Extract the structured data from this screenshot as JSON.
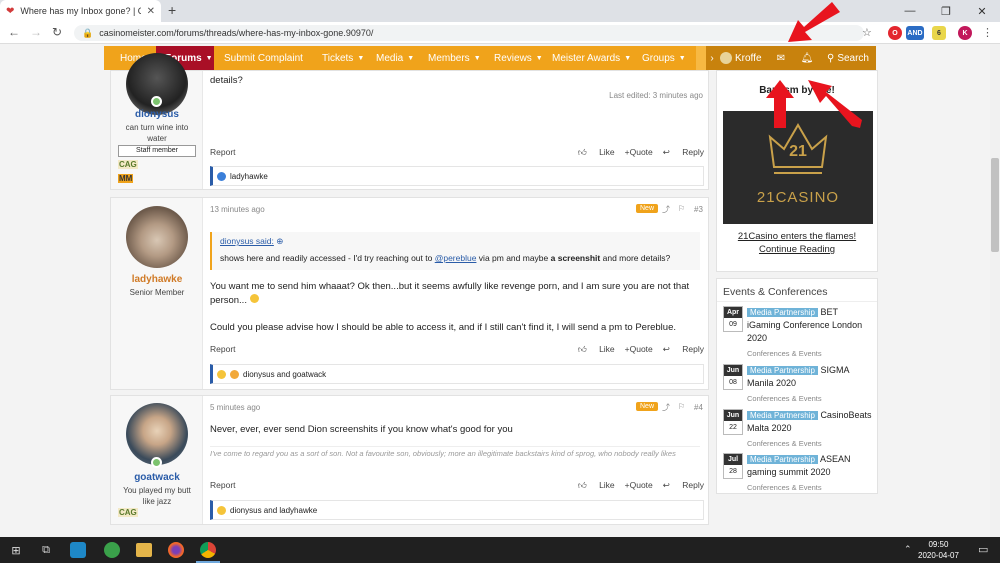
{
  "browser": {
    "tab_title": "Where has my Inbox gone? | Casi",
    "url": "casinomeister.com/forums/threads/where-has-my-inbox-gone.90970/",
    "ext_and": "AND",
    "ext_count": "6",
    "profile_letter": "K"
  },
  "nav": {
    "items": [
      "Home",
      "Forums",
      "Submit Complaint",
      "Tickets",
      "Media",
      "Members",
      "Reviews",
      "Meister Awards",
      "Groups"
    ],
    "user": "Kroffe",
    "search": "Search"
  },
  "posts": [
    {
      "username": "dionysus",
      "user_title": "can turn wine into water",
      "staff": "Staff member",
      "badges": [
        "CAG",
        "MM"
      ],
      "text": "details?",
      "edited": "Last edited: 3 minutes ago",
      "report": "Report",
      "like": "Like",
      "quote": "+Quote",
      "reply": "Reply",
      "reactions": "ladyhawke"
    },
    {
      "username": "ladyhawke",
      "user_title": "Senior Member",
      "time": "13 minutes ago",
      "new": "New",
      "num": "#3",
      "quote_author": "dionysus said:",
      "quote_text_a": "shows here and readily accessed - I'd try reaching out to ",
      "quote_mention": "@pereblue",
      "quote_text_b": " via pm and maybe ",
      "quote_bold": "a screenshit",
      "quote_text_c": " and more details?",
      "text1": "You want me to send him whaaat? Ok then...but it seems awfully like revenge porn, and I am sure you are not that person...",
      "text2": "Could you please advise how I should be able to access it, and if I still can't find it, I will send a pm to Pereblue.",
      "report": "Report",
      "like": "Like",
      "quote": "+Quote",
      "reply": "Reply",
      "reactions": "dionysus and goatwack"
    },
    {
      "username": "goatwack",
      "user_title": "You played my butt like jazz",
      "badges": [
        "CAG"
      ],
      "time": "5 minutes ago",
      "new": "New",
      "num": "#4",
      "text": "Never, ever, ever send Dion screenshits if you know what's good for you",
      "signature": "I've come to regard you as a sort of son. Not a favourite son, obviously; more an illegitimate backstairs kind of sprog, who nobody really likes",
      "report": "Report",
      "like": "Like",
      "quote": "+Quote",
      "reply": "Reply",
      "reactions": "dionysus and ladyhawke"
    }
  ],
  "sidebar": {
    "promo_title": "Baptism by fire!",
    "logo_top": "21",
    "logo_text": "21CASINO",
    "promo_link": "21Casino enters the flames!",
    "promo_more": "Continue Reading",
    "events_title": "Events & Conferences",
    "partnership": "Media Partnership",
    "category": "Conferences & Events",
    "events": [
      {
        "month": "Apr",
        "day": "09",
        "title": "BET iGaming Conference London 2020"
      },
      {
        "month": "Jun",
        "day": "08",
        "title": "SIGMA Manila 2020"
      },
      {
        "month": "Jun",
        "day": "22",
        "title": "CasinoBeats Malta 2020"
      },
      {
        "month": "Jul",
        "day": "28",
        "title": "ASEAN gaming summit 2020"
      }
    ]
  },
  "taskbar": {
    "time": "09:50",
    "date": "2020-04-07"
  },
  "colors": {
    "nav": "#f0a31b",
    "nav_active": "#a90f26",
    "link": "#2a5ca8",
    "arrow": "#e8141e"
  }
}
